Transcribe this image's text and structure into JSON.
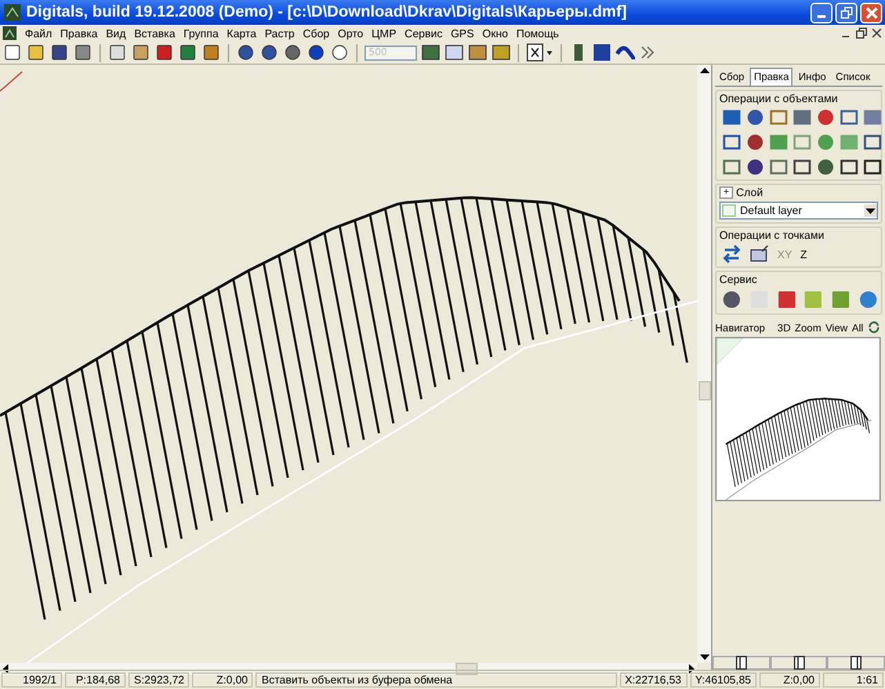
{
  "window": {
    "title": "Digitals, build 19.12.2008 (Demo) - [c:\\D\\Download\\Dkrav\\Digitals\\Карьеры.dmf]"
  },
  "menu": [
    "Файл",
    "Правка",
    "Вид",
    "Вставка",
    "Группа",
    "Карта",
    "Растр",
    "Сбор",
    "Орто",
    "ЦМР",
    "Сервис",
    "GPS",
    "Окно",
    "Помощь"
  ],
  "toolbar": {
    "scale_field": {
      "value": "500",
      "disabled": true
    }
  },
  "panel": {
    "tabs": [
      {
        "label": "Сбор",
        "selected": false
      },
      {
        "label": "Правка",
        "selected": true
      },
      {
        "label": "Инфо",
        "selected": false
      },
      {
        "label": "Список",
        "selected": false
      }
    ],
    "object_ops": {
      "title": "Операции с объектами"
    },
    "layer": {
      "toggle": "+",
      "title": "Слой",
      "value": "Default layer"
    },
    "point_ops": {
      "title": "Операции с точками",
      "buttons": [
        {
          "label": "XY",
          "disabled": true
        },
        {
          "label": "Z",
          "disabled": false
        }
      ]
    },
    "service": {
      "title": "Сервис"
    },
    "navigator": {
      "title": "Навигатор",
      "buttons": [
        "3D",
        "Zoom",
        "View",
        "All"
      ]
    }
  },
  "status_bar": {
    "left": [
      "1992/1",
      "P:184,68",
      "S:2923,72",
      "Z:0,00"
    ],
    "message": "Вставить объекты из буфера обмена",
    "right": [
      "X:22716,53",
      "Y:46105,85",
      "Z:0,00",
      "1:61"
    ]
  }
}
